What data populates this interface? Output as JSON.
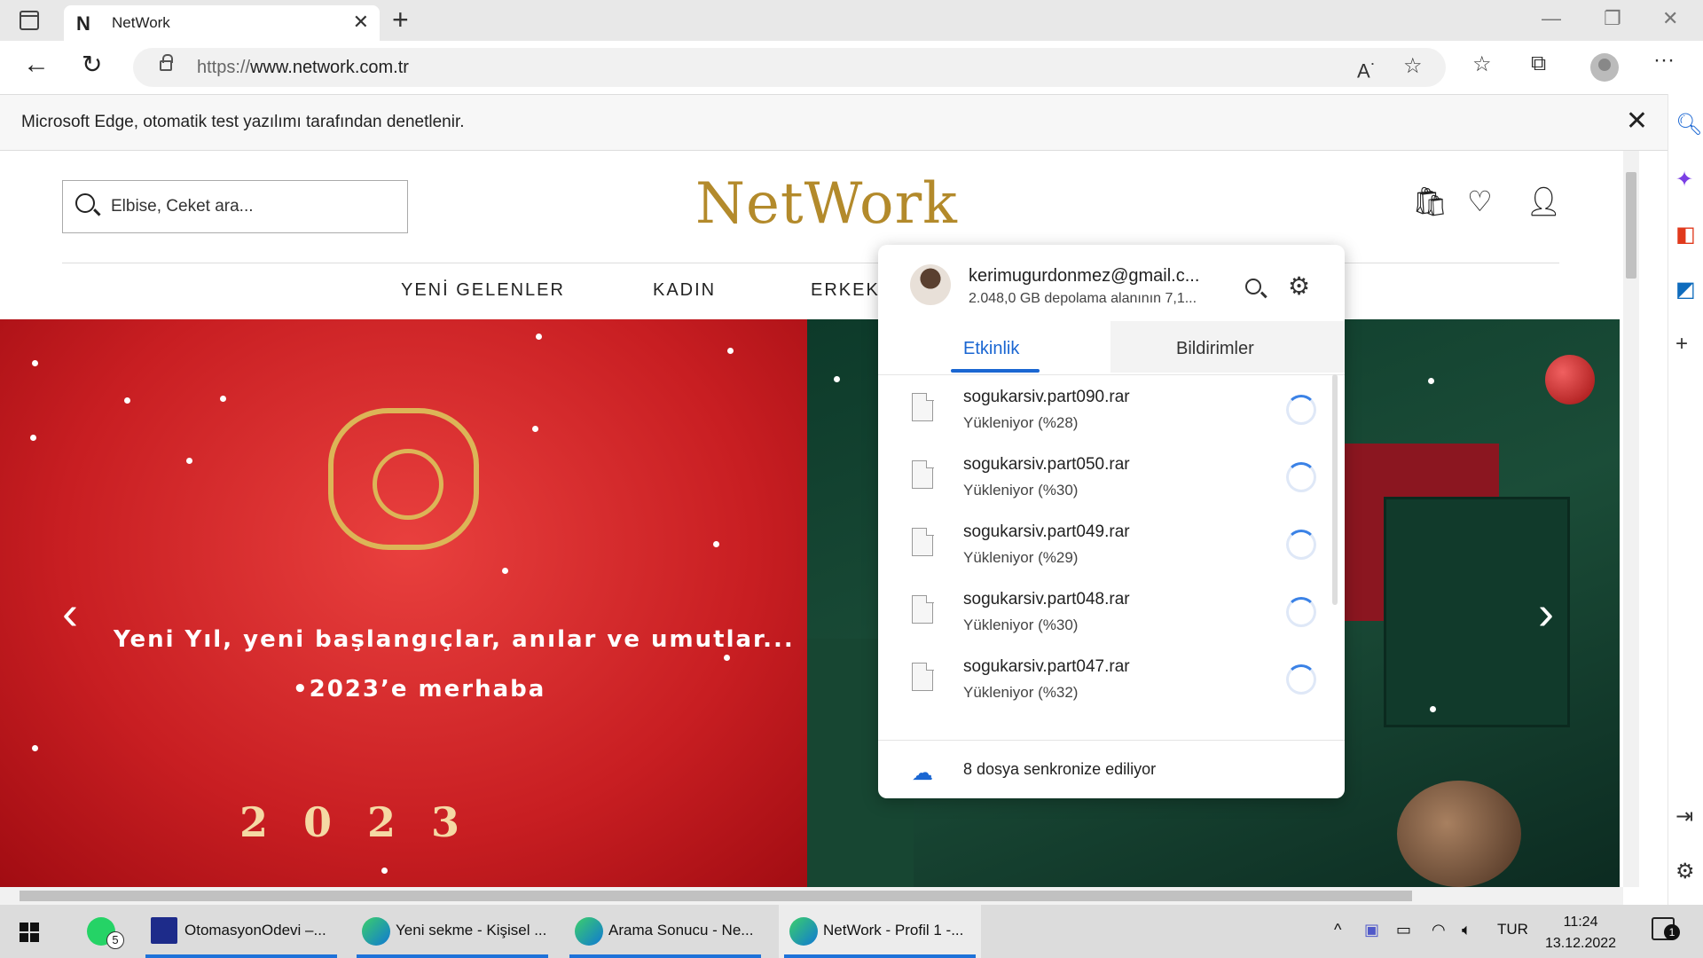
{
  "browser": {
    "tab_title": "NetWork",
    "tab_favicon": "N",
    "url_scheme": "https://",
    "url_host": "www.network.com.tr",
    "infobar_message": "Microsoft Edge, otomatik test yazılımı tarafından denetlenir."
  },
  "site": {
    "search_placeholder": "Elbise, Ceket ara...",
    "logo": "NetWork",
    "menu": [
      "YENİ GELENLER",
      "KADIN",
      "ERKEK"
    ],
    "banner": {
      "line1": "Yeni Yıl, yeni başlangıçlar, anılar ve umutlar...",
      "line2": "•2023’e merhaba",
      "year": "2023",
      "prev_arrow": "‹",
      "next_arrow": "›"
    }
  },
  "drive_popup": {
    "email": "kerimugurdonmez@gmail.c...",
    "storage": "2.048,0 GB depolama alanının 7,1...",
    "tabs": [
      "Etkinlik",
      "Bildirimler"
    ],
    "items": [
      {
        "name": "sogukarsiv.part090.rar",
        "status": "Yükleniyor (%28)"
      },
      {
        "name": "sogukarsiv.part050.rar",
        "status": "Yükleniyor (%30)"
      },
      {
        "name": "sogukarsiv.part049.rar",
        "status": "Yükleniyor (%29)"
      },
      {
        "name": "sogukarsiv.part048.rar",
        "status": "Yükleniyor (%30)"
      },
      {
        "name": "sogukarsiv.part047.rar",
        "status": "Yükleniyor (%32)"
      }
    ],
    "footer": "8 dosya senkronize ediliyor"
  },
  "taskbar": {
    "items": [
      {
        "label": "",
        "icon": "whatsapp-icon",
        "badge": "5"
      },
      {
        "label": "OtomasyonOdevi –...",
        "icon": "intellij-icon"
      },
      {
        "label": "Yeni sekme - Kişisel ...",
        "icon": "edge-icon"
      },
      {
        "label": "Arama Sonucu - Ne...",
        "icon": "edge-icon"
      },
      {
        "label": "NetWork - Profil 1 -...",
        "icon": "edge-icon"
      }
    ],
    "language": "TUR",
    "time": "11:24",
    "date": "13.12.2022",
    "notifications": "1"
  },
  "colors": {
    "accent": "#1a66d2",
    "logo_gold": "#b38a2b",
    "banner_red": "#d6292c"
  }
}
